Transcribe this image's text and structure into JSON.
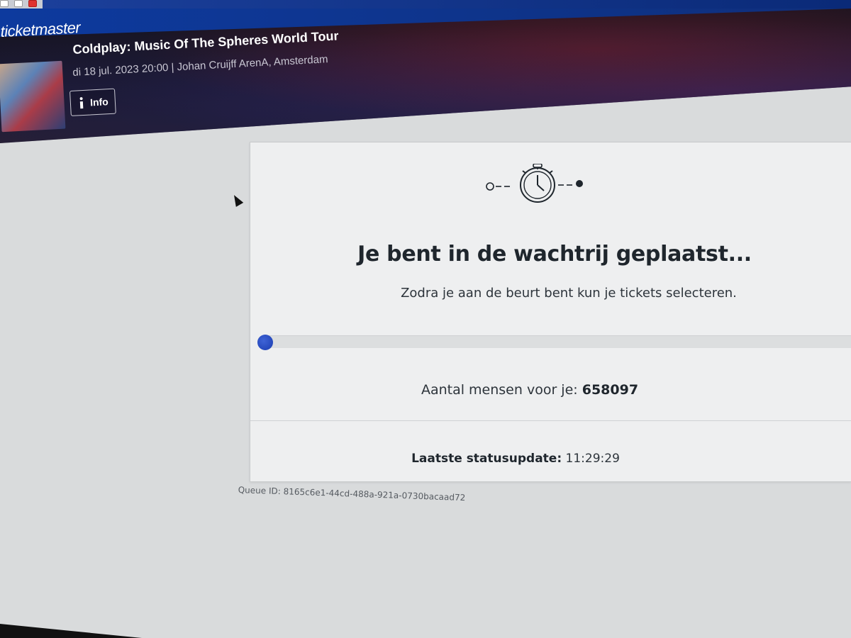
{
  "brand": {
    "logo_text": "ticketmaster",
    "accent_color": "#0d3a9e"
  },
  "event": {
    "title": "Coldplay: Music Of The Spheres World Tour",
    "meta": "di 18 jul. 2023 20:00 | Johan Cruijff ArenA, Amsterdam",
    "info_label": "Info",
    "info_icon": "info-icon"
  },
  "queue": {
    "icon": "stopwatch-icon",
    "heading": "Je bent in de wachtrij geplaatst...",
    "subheading": "Zodra je aan de beurt bent kun je tickets selecteren.",
    "progress_fraction": 0.0,
    "people_ahead_label": "Aantal mensen voor je:",
    "people_ahead_value": "658097",
    "status_label": "Laatste statusupdate:",
    "status_time": "11:29:29",
    "queue_id": "Queue ID: 8165c6e1-44cd-488a-921a-0730bacaad72",
    "progress_color": "#1a3cb0"
  }
}
